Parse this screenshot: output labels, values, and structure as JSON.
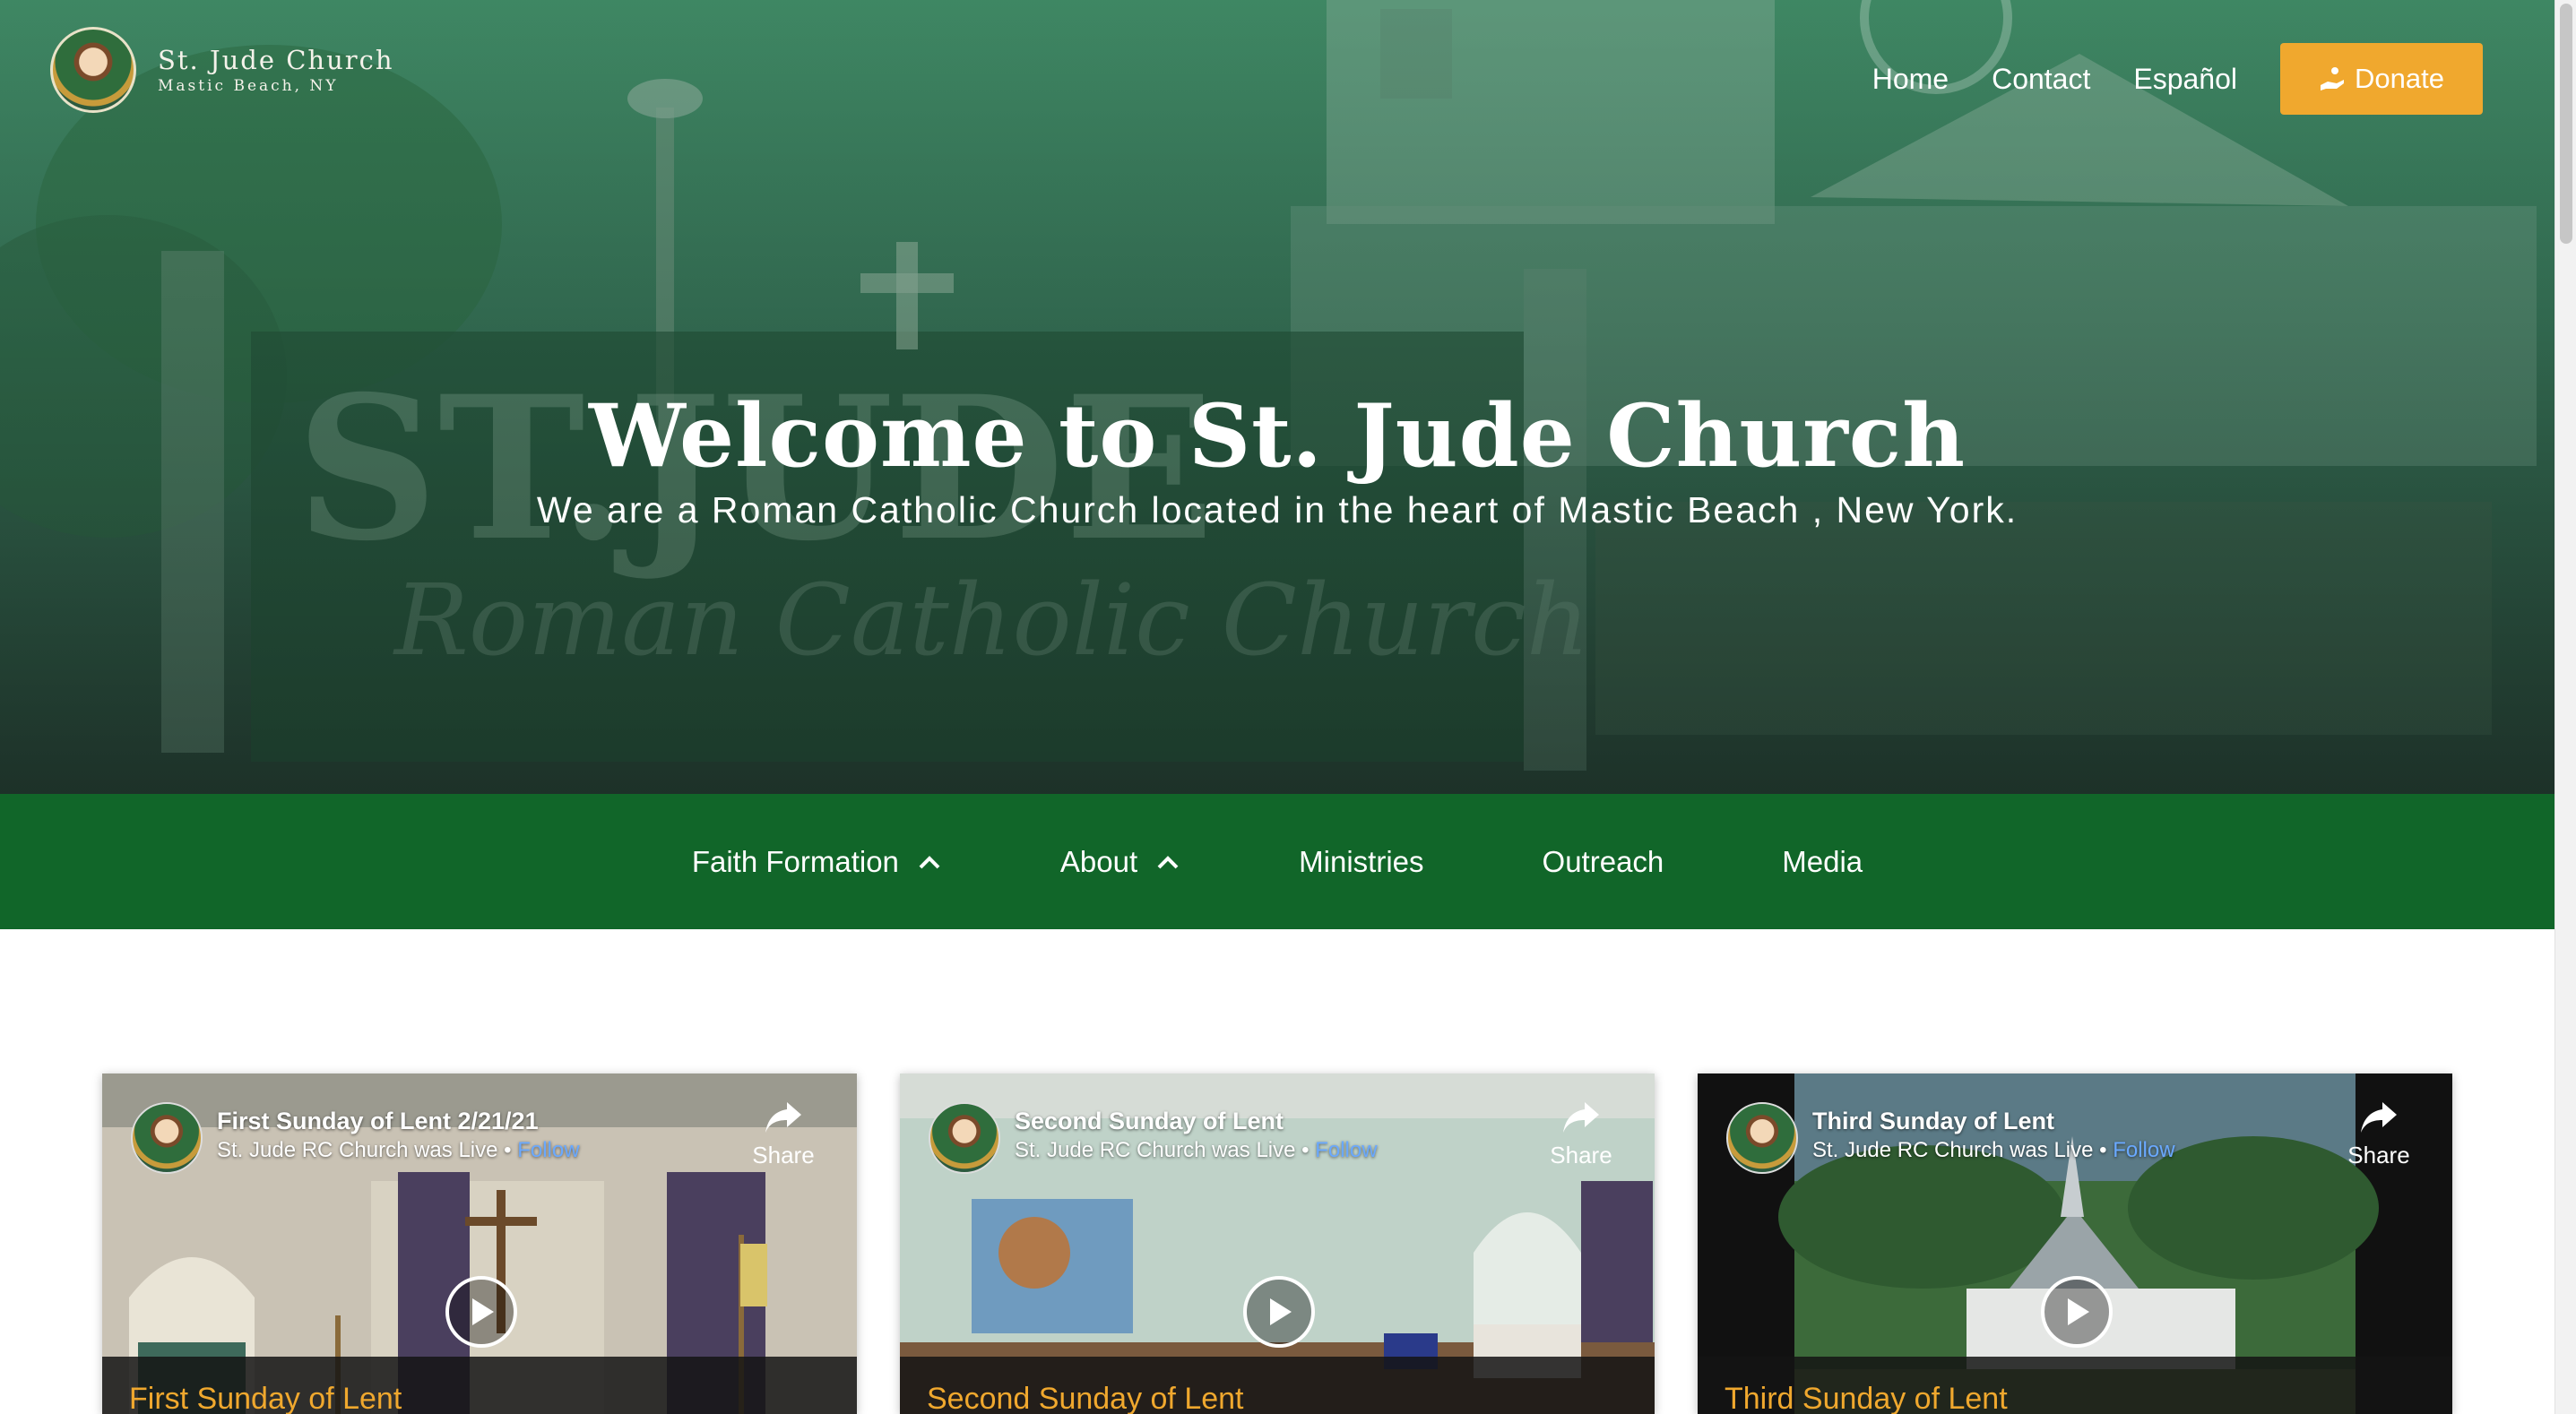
{
  "brand": {
    "name": "St. Jude Church",
    "location": "Mastic Beach, NY"
  },
  "topnav": {
    "home": "Home",
    "contact": "Contact",
    "espanol": "Español",
    "donate": "Donate"
  },
  "hero": {
    "title": "Welcome to St. Jude Church",
    "subtitle": "We are a Roman Catholic Church located in the heart of Mastic Beach , New York."
  },
  "secnav": {
    "items": [
      {
        "label": "Faith Formation",
        "has_dropdown": true,
        "icon": "chevron-up-icon"
      },
      {
        "label": "About",
        "has_dropdown": true,
        "icon": "chevron-up-icon"
      },
      {
        "label": "Ministries",
        "has_dropdown": false
      },
      {
        "label": "Outreach",
        "has_dropdown": false
      },
      {
        "label": "Media",
        "has_dropdown": false
      }
    ]
  },
  "videos": [
    {
      "title": "First Sunday of Lent 2/21/21",
      "channel_line": "St. Jude RC Church was Live •",
      "follow": "Follow",
      "share": "Share",
      "caption": "First Sunday of Lent"
    },
    {
      "title": "Second Sunday of Lent",
      "channel_line": "St. Jude RC Church was Live •",
      "follow": "Follow",
      "share": "Share",
      "caption": "Second Sunday of Lent"
    },
    {
      "title": "Third Sunday of Lent",
      "channel_line": "St. Jude RC Church was Live •",
      "follow": "Follow",
      "share": "Share",
      "caption": "Third Sunday of Lent"
    }
  ],
  "colors": {
    "nav_green": "#116629",
    "donate_orange": "#f0a82e",
    "caption_orange": "#f0a82e",
    "link_blue": "#6aa9ff"
  }
}
